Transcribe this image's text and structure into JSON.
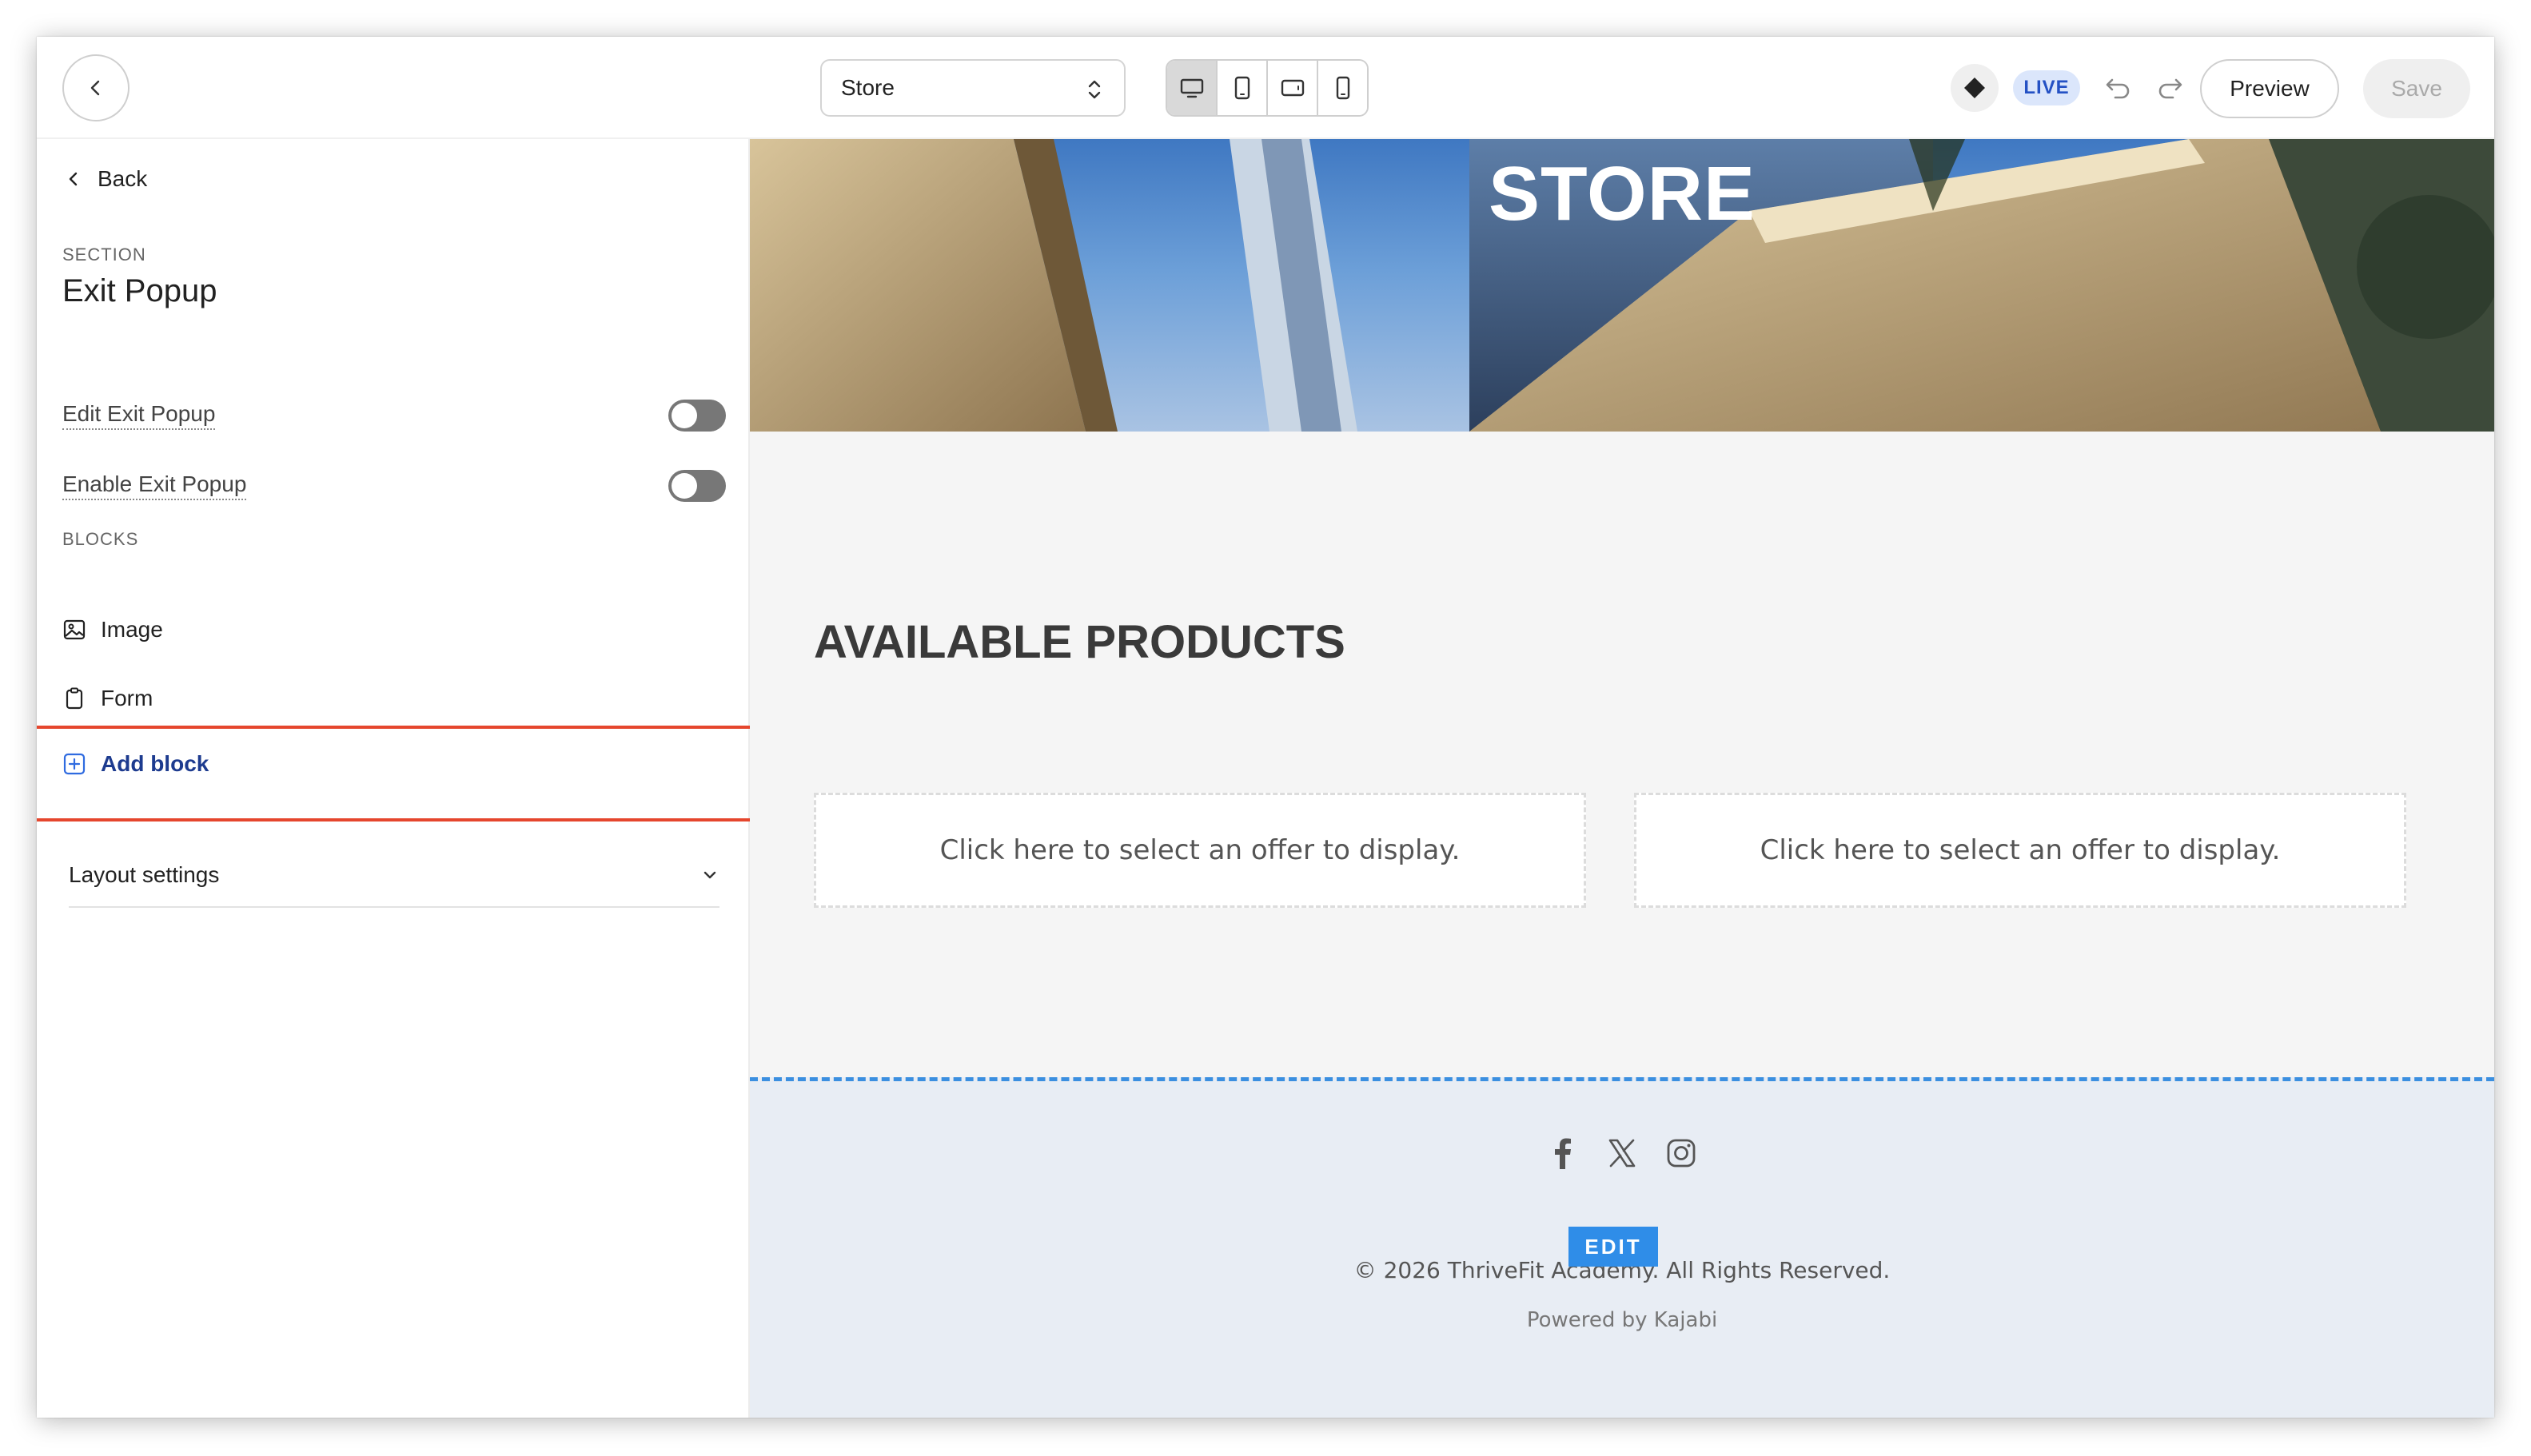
{
  "topbar": {
    "page_selector_value": "Store",
    "live_badge": "LIVE",
    "preview_label": "Preview",
    "save_label": "Save"
  },
  "sidebar": {
    "back_label": "Back",
    "section_label": "SECTION",
    "section_title": "Exit Popup",
    "toggles": [
      {
        "label": "Edit Exit Popup",
        "state": "off"
      },
      {
        "label": "Enable Exit Popup",
        "state": "off"
      }
    ],
    "blocks_label": "BLOCKS",
    "blocks": [
      {
        "label": "Image",
        "icon": "image-icon"
      },
      {
        "label": "Form",
        "icon": "clipboard-icon"
      }
    ],
    "add_block_label": "Add block",
    "layout_settings_label": "Layout settings"
  },
  "canvas": {
    "hero_title": "STORE",
    "products_title": "AVAILABLE PRODUCTS",
    "offer_placeholders": [
      "Click here to select an offer to display.",
      "Click here to select an offer to display."
    ],
    "footer": {
      "social_icons": [
        "facebook-icon",
        "x-icon",
        "instagram-icon"
      ],
      "edit_tag": "EDIT",
      "copyright": "© 2026 ThriveFit Academy. All Rights Reserved.",
      "powered_by": "Powered by Kajabi"
    }
  },
  "colors": {
    "accent_blue": "#2f8de8",
    "live_badge_bg": "#dbe6fb",
    "highlight_red": "#e5462d",
    "add_block_text": "#1d3b8f"
  }
}
